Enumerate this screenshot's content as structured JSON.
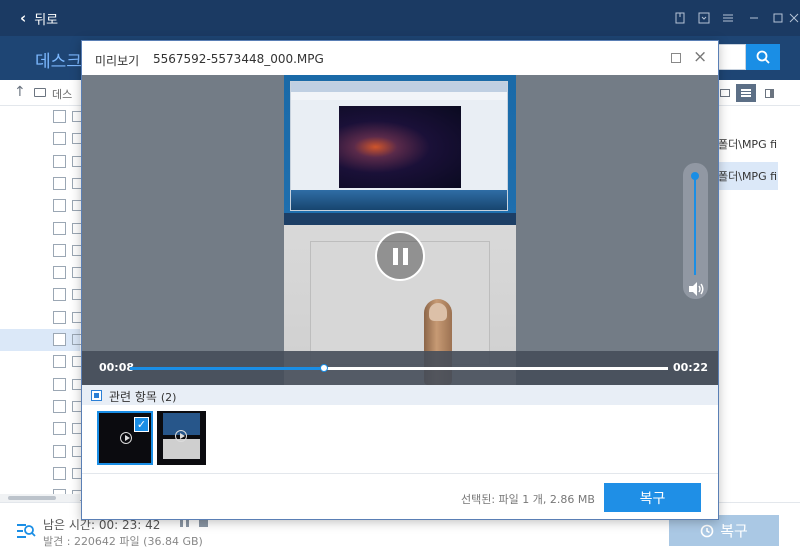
{
  "titlebar": {
    "back_label": "뒤로"
  },
  "location": {
    "title": "데스크"
  },
  "pathbar": {
    "label": "데스"
  },
  "file_list": {
    "rows": [
      {
        "path": "폴더\\MPG file..."
      },
      {
        "path": "폴더\\MPG file..."
      }
    ]
  },
  "scan_status": {
    "remaining": "남은 시간: 00: 23: 42",
    "found": "발견 : 220642 파일 (36.84 GB)"
  },
  "main_recover_label": "복구",
  "preview": {
    "title": "미리보기",
    "filename": "5567592-5573448_000.MPG",
    "current_time": "00:08",
    "total_time": "00:22",
    "progress": 0.36,
    "volume": 1.0,
    "related_label": "관련 항목",
    "related_count": "(2)",
    "selected_info": "선택된: 파일 1 개, 2.86 MB",
    "recover_label": "복구"
  },
  "colors": {
    "titlebar": "#1b3a63",
    "accent": "#1a8ee5",
    "selection": "#dbe8f8"
  },
  "icons": {
    "back": "chevron-left-icon",
    "search": "search-icon",
    "pause": "pause-icon",
    "volume": "speaker-icon",
    "recover": "restore-icon"
  }
}
